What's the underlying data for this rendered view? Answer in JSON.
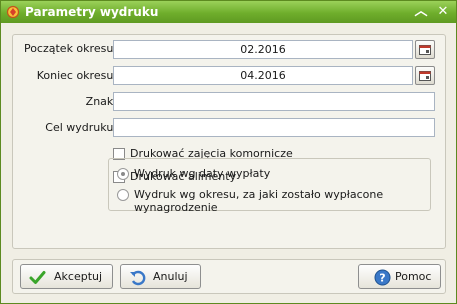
{
  "window": {
    "title": "Parametry wydruku",
    "minimize_icon": "minimize-icon",
    "close_icon": "close-icon",
    "app_icon": "app-icon"
  },
  "form": {
    "start_label": "Początek okresu:",
    "start_value": "02.2016",
    "end_label": "Koniec okresu:",
    "end_value": "04.2016",
    "sign_label": "Znak:",
    "sign_value": "",
    "purpose_label": "Cel wydruku:",
    "purpose_value": "",
    "calendar_icon": "calendar-icon"
  },
  "checkboxes": [
    {
      "label": "Drukować zajęcia komornicze",
      "checked": false
    },
    {
      "label": "Drukować alimenty",
      "checked": false
    }
  ],
  "radios": [
    {
      "label": "Wydruk wg daty wypłaty",
      "checked": true
    },
    {
      "label": "Wydruk wg okresu, za jaki zostało wypłacone wynagrodzenie",
      "checked": false
    }
  ],
  "buttons": {
    "accept": "Akceptuj",
    "cancel": "Anuluj",
    "help": "Pomoc"
  },
  "colors": {
    "titlebar": "#6fae2c",
    "accept_icon": "#3aa52a",
    "help_icon": "#3a78c8"
  }
}
